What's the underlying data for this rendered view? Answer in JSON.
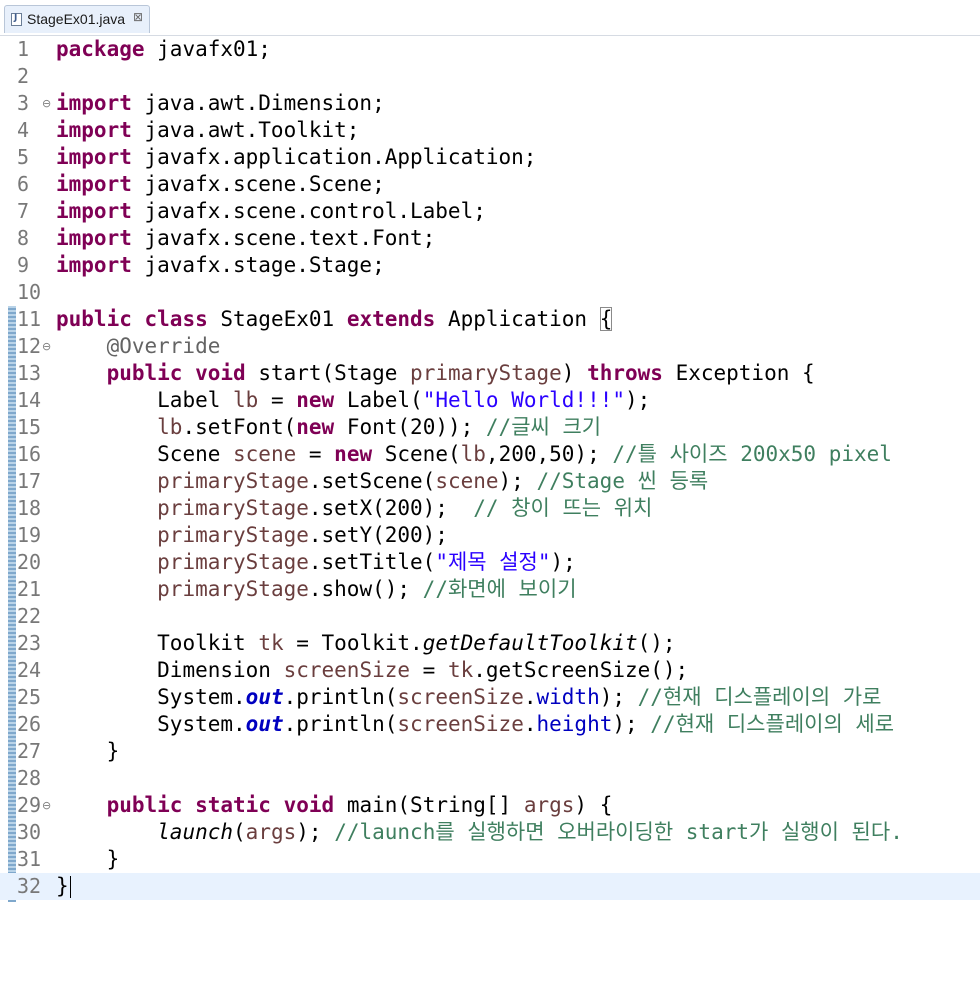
{
  "tab": {
    "label": "StageEx01.java",
    "close": "⊠"
  },
  "lines": [
    {
      "n": "1"
    },
    {
      "n": "2"
    },
    {
      "n": "3"
    },
    {
      "n": "4"
    },
    {
      "n": "5"
    },
    {
      "n": "6"
    },
    {
      "n": "7"
    },
    {
      "n": "8"
    },
    {
      "n": "9"
    },
    {
      "n": "10"
    },
    {
      "n": "11"
    },
    {
      "n": "12"
    },
    {
      "n": "13"
    },
    {
      "n": "14"
    },
    {
      "n": "15"
    },
    {
      "n": "16"
    },
    {
      "n": "17"
    },
    {
      "n": "18"
    },
    {
      "n": "19"
    },
    {
      "n": "20"
    },
    {
      "n": "21"
    },
    {
      "n": "22"
    },
    {
      "n": "23"
    },
    {
      "n": "24"
    },
    {
      "n": "25"
    },
    {
      "n": "26"
    },
    {
      "n": "27"
    },
    {
      "n": "28"
    },
    {
      "n": "29"
    },
    {
      "n": "30"
    },
    {
      "n": "31"
    },
    {
      "n": "32"
    }
  ],
  "code": {
    "l1": {
      "kw": "package",
      "rest": " javafx01;"
    },
    "l3": {
      "kw": "import",
      "rest": " java.awt.Dimension;"
    },
    "l4": {
      "kw": "import",
      "rest": " java.awt.Toolkit;"
    },
    "l5": {
      "kw": "import",
      "rest": " javafx.application.Application;"
    },
    "l6": {
      "kw": "import",
      "rest": " javafx.scene.Scene;"
    },
    "l7": {
      "kw": "import",
      "rest": " javafx.scene.control.Label;"
    },
    "l8": {
      "kw": "import",
      "rest": " javafx.scene.text.Font;"
    },
    "l9": {
      "kw": "import",
      "rest": " javafx.stage.Stage;"
    },
    "l11": {
      "kw1": "public",
      "kw2": "class",
      "name": " StageEx01 ",
      "kw3": "extends",
      "rest": " Application ",
      "brace": "{"
    },
    "l12": {
      "ann": "@Override"
    },
    "l13": {
      "kw1": "public",
      "kw2": "void",
      "a": " start(Stage ",
      "p": "primaryStage",
      "b": ") ",
      "kw3": "throws",
      "c": " Exception {"
    },
    "l14": {
      "a": "Label ",
      "v": "lb",
      "b": " = ",
      "kw": "new",
      "c": " Label(",
      "s": "\"Hello World!!!\"",
      "d": ");"
    },
    "l15": {
      "v": "lb",
      "a": ".setFont(",
      "kw": "new",
      "b": " Font(20)); ",
      "cm": "//글씨 크기"
    },
    "l16": {
      "a": "Scene ",
      "v": "scene",
      "b": " = ",
      "kw": "new",
      "c": " Scene(",
      "v2": "lb",
      "d": ",200,50); ",
      "cm": "//틀 사이즈 200x50 pixel"
    },
    "l17": {
      "v": "primaryStage",
      "a": ".setScene(",
      "v2": "scene",
      "b": "); ",
      "cm": "//Stage 씬 등록"
    },
    "l18": {
      "v": "primaryStage",
      "a": ".setX(200);  ",
      "cm": "// 창이 뜨는 위치"
    },
    "l19": {
      "v": "primaryStage",
      "a": ".setY(200);"
    },
    "l20": {
      "v": "primaryStage",
      "a": ".setTitle(",
      "s": "\"제목 설정\"",
      "b": ");"
    },
    "l21": {
      "v": "primaryStage",
      "a": ".show(); ",
      "cm": "//화면에 보이기"
    },
    "l23": {
      "a": "Toolkit ",
      "v": "tk",
      "b": " = Toolkit.",
      "i": "getDefaultToolkit",
      "c": "();"
    },
    "l24": {
      "a": "Dimension ",
      "v": "screenSize",
      "b": " = ",
      "v2": "tk",
      "c": ".getScreenSize();"
    },
    "l25": {
      "a": "System.",
      "sf": "out",
      "b": ".println(",
      "v": "screenSize",
      "c": ".",
      "f": "width",
      "d": "); ",
      "cm": "//현재 디스플레이의 가로"
    },
    "l26": {
      "a": "System.",
      "sf": "out",
      "b": ".println(",
      "v": "screenSize",
      "c": ".",
      "f": "height",
      "d": "); ",
      "cm": "//현재 디스플레이의 세로"
    },
    "l27": {
      "a": "}"
    },
    "l29": {
      "kw1": "public",
      "kw2": "static",
      "kw3": "void",
      "a": " main(String[] ",
      "v": "args",
      "b": ") {"
    },
    "l30": {
      "i": "launch",
      "a": "(",
      "v": "args",
      "b": "); ",
      "cm": "//launch를 실행하면 오버라이딩한 start가 실행이 된다."
    },
    "l31": {
      "a": "}"
    },
    "l32": {
      "a": "}"
    }
  },
  "fold_marker": "⊖",
  "colors": {
    "keyword": "#7f0055",
    "string": "#2a00ff",
    "comment": "#3f7f5f",
    "variable": "#6a3e3e",
    "field": "#0000c0",
    "annotation": "#646464",
    "current_line": "#e8f2fe"
  }
}
